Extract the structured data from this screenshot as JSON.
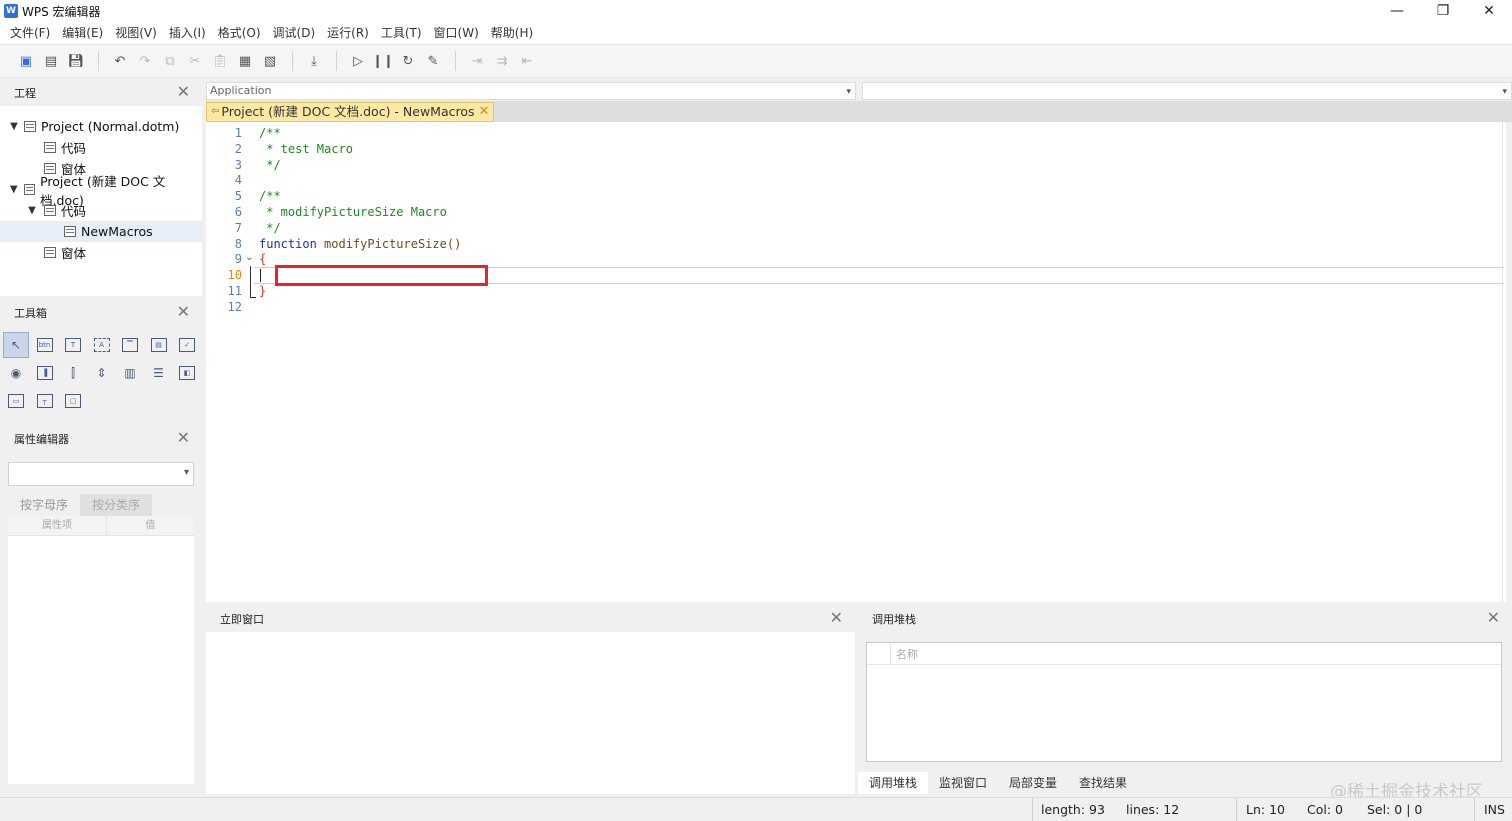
{
  "window": {
    "title": "WPS 宏编辑器",
    "icon_letter": "W"
  },
  "menu": [
    "文件(F)",
    "编辑(E)",
    "视图(V)",
    "插入(I)",
    "格式(O)",
    "调试(D)",
    "运行(R)",
    "工具(T)",
    "窗口(W)",
    "帮助(H)"
  ],
  "project_panel": {
    "title": "工程",
    "tree": [
      {
        "label": "Project (Normal.dotm)",
        "level": 0,
        "expanded": true
      },
      {
        "label": "代码",
        "level": 1
      },
      {
        "label": "窗体",
        "level": 1
      },
      {
        "label": "Project (新建 DOC 文档.doc)",
        "level": 0,
        "expanded": true
      },
      {
        "label": "代码",
        "level": 1,
        "expanded": true
      },
      {
        "label": "NewMacros",
        "level": 2,
        "selected": true
      },
      {
        "label": "窗体",
        "level": 1
      }
    ]
  },
  "toolbox_panel": {
    "title": "工具箱"
  },
  "property_panel": {
    "title": "属性编辑器",
    "tabs": [
      "按字母序",
      "按分类序"
    ],
    "columns": [
      "属性项",
      "值"
    ]
  },
  "editor": {
    "object_combo": "Application",
    "procedure_combo": "",
    "tab_label": "Project (新建 DOC 文档.doc) - NewMacros",
    "current_line": 10,
    "lines": [
      {
        "n": "1",
        "text": "/**",
        "kind": "comment"
      },
      {
        "n": "2",
        "text": " * test Macro",
        "kind": "comment"
      },
      {
        "n": "3",
        "text": " */",
        "kind": "comment"
      },
      {
        "n": "4",
        "text": "",
        "kind": "plain"
      },
      {
        "n": "5",
        "text": "/**",
        "kind": "comment"
      },
      {
        "n": "6",
        "text": " * modifyPictureSize Macro",
        "kind": "comment"
      },
      {
        "n": "7",
        "text": " */",
        "kind": "comment"
      },
      {
        "n": "8",
        "text": "function modifyPictureSize()",
        "kind": "function"
      },
      {
        "n": "9",
        "text": "{",
        "kind": "brace"
      },
      {
        "n": "10",
        "text": "",
        "kind": "plain"
      },
      {
        "n": "11",
        "text": "}",
        "kind": "brace"
      },
      {
        "n": "12",
        "text": "",
        "kind": "plain"
      }
    ]
  },
  "immediate_panel": {
    "title": "立即窗口"
  },
  "callstack_panel": {
    "title": "调用堆栈",
    "column": "名称",
    "tabs": [
      "调用堆栈",
      "监视窗口",
      "局部变量",
      "查找结果"
    ]
  },
  "status": {
    "length": "length: 93",
    "lines": "lines: 12",
    "ln": "Ln: 10",
    "col": "Col: 0",
    "sel": "Sel: 0 | 0",
    "mode": "INS"
  },
  "watermark": "@稀土掘金技术社区",
  "colors": {
    "accent": "#2f6fde",
    "highlight_box": "#e8242b",
    "tab_bg": "#fde9a4"
  }
}
